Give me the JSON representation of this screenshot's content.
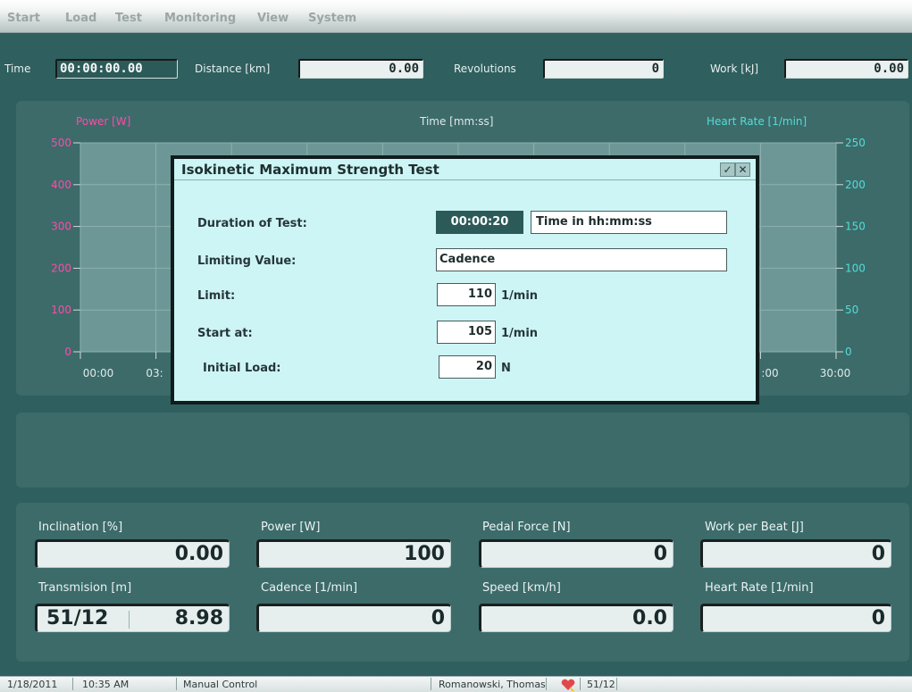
{
  "menu": {
    "items": [
      "Start",
      "Load",
      "Test",
      "Monitoring",
      "View",
      "System"
    ]
  },
  "topbar": {
    "time_label": "Time",
    "time_value": "00:00:00.00",
    "distance_label": "Distance [km]",
    "distance_value": "0.00",
    "revolutions_label": "Revolutions",
    "revolutions_value": "0",
    "work_label": "Work [kJ]",
    "work_value": "0.00"
  },
  "chart": {
    "left_axis_title": "Power [W]",
    "center_title": "Time [mm:ss]",
    "right_axis_title": "Heart Rate [1/min]",
    "left_ticks": [
      "500",
      "400",
      "300",
      "200",
      "100",
      "0"
    ],
    "right_ticks": [
      "250",
      "200",
      "150",
      "100",
      "50",
      "0"
    ],
    "x_ticks_left": [
      "00:00",
      "03:"
    ],
    "x_ticks_right": [
      ":00",
      "30:00"
    ],
    "colors": {
      "power": "#ff4aa8",
      "heart_rate": "#52ddd6",
      "plot_bg": "#6d9796"
    }
  },
  "dialog": {
    "title": "Isokinetic Maximum Strength Test",
    "duration_label": "Duration of Test:",
    "duration_value": "00:00:20",
    "duration_hint": "Time in hh:mm:ss",
    "limiting_label": "Limiting Value:",
    "limiting_value": "Cadence",
    "limit_label": "Limit:",
    "limit_value": "110",
    "limit_unit": "1/min",
    "start_label": "Start at:",
    "start_value": "105",
    "start_unit": "1/min",
    "initial_label": "Initial Load:",
    "initial_value": "20",
    "initial_unit": "N",
    "ok_icon": "check-icon",
    "close_icon": "close-icon"
  },
  "gauges": {
    "inclination_label": "Inclination [%]",
    "inclination_value": "0.00",
    "power_label": "Power [W]",
    "power_value": "100",
    "pedal_label": "Pedal Force [N]",
    "pedal_value": "0",
    "work_beat_label": "Work per Beat [J]",
    "work_beat_value": "0",
    "transmission_label": "Transmision [m]",
    "transmission_gear": "51/12",
    "transmission_value": "8.98",
    "cadence_label": "Cadence [1/min]",
    "cadence_value": "0",
    "speed_label": "Speed [km/h]",
    "speed_value": "0.0",
    "heart_label": "Heart Rate [1/min]",
    "heart_value": "0"
  },
  "status": {
    "date": "1/18/2011",
    "time": "10:35 AM",
    "mode": "Manual Control",
    "user": "Romanowski, Thomas",
    "gear": "51/12",
    "heart_icon": "heart-icon"
  }
}
